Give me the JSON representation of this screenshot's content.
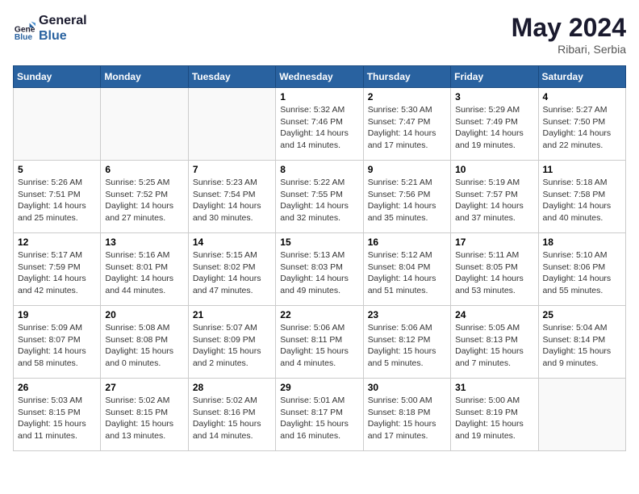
{
  "header": {
    "logo_line1": "General",
    "logo_line2": "Blue",
    "month": "May 2024",
    "location": "Ribari, Serbia"
  },
  "weekdays": [
    "Sunday",
    "Monday",
    "Tuesday",
    "Wednesday",
    "Thursday",
    "Friday",
    "Saturday"
  ],
  "weeks": [
    [
      {
        "day": "",
        "info": ""
      },
      {
        "day": "",
        "info": ""
      },
      {
        "day": "",
        "info": ""
      },
      {
        "day": "1",
        "info": "Sunrise: 5:32 AM\nSunset: 7:46 PM\nDaylight: 14 hours\nand 14 minutes."
      },
      {
        "day": "2",
        "info": "Sunrise: 5:30 AM\nSunset: 7:47 PM\nDaylight: 14 hours\nand 17 minutes."
      },
      {
        "day": "3",
        "info": "Sunrise: 5:29 AM\nSunset: 7:49 PM\nDaylight: 14 hours\nand 19 minutes."
      },
      {
        "day": "4",
        "info": "Sunrise: 5:27 AM\nSunset: 7:50 PM\nDaylight: 14 hours\nand 22 minutes."
      }
    ],
    [
      {
        "day": "5",
        "info": "Sunrise: 5:26 AM\nSunset: 7:51 PM\nDaylight: 14 hours\nand 25 minutes."
      },
      {
        "day": "6",
        "info": "Sunrise: 5:25 AM\nSunset: 7:52 PM\nDaylight: 14 hours\nand 27 minutes."
      },
      {
        "day": "7",
        "info": "Sunrise: 5:23 AM\nSunset: 7:54 PM\nDaylight: 14 hours\nand 30 minutes."
      },
      {
        "day": "8",
        "info": "Sunrise: 5:22 AM\nSunset: 7:55 PM\nDaylight: 14 hours\nand 32 minutes."
      },
      {
        "day": "9",
        "info": "Sunrise: 5:21 AM\nSunset: 7:56 PM\nDaylight: 14 hours\nand 35 minutes."
      },
      {
        "day": "10",
        "info": "Sunrise: 5:19 AM\nSunset: 7:57 PM\nDaylight: 14 hours\nand 37 minutes."
      },
      {
        "day": "11",
        "info": "Sunrise: 5:18 AM\nSunset: 7:58 PM\nDaylight: 14 hours\nand 40 minutes."
      }
    ],
    [
      {
        "day": "12",
        "info": "Sunrise: 5:17 AM\nSunset: 7:59 PM\nDaylight: 14 hours\nand 42 minutes."
      },
      {
        "day": "13",
        "info": "Sunrise: 5:16 AM\nSunset: 8:01 PM\nDaylight: 14 hours\nand 44 minutes."
      },
      {
        "day": "14",
        "info": "Sunrise: 5:15 AM\nSunset: 8:02 PM\nDaylight: 14 hours\nand 47 minutes."
      },
      {
        "day": "15",
        "info": "Sunrise: 5:13 AM\nSunset: 8:03 PM\nDaylight: 14 hours\nand 49 minutes."
      },
      {
        "day": "16",
        "info": "Sunrise: 5:12 AM\nSunset: 8:04 PM\nDaylight: 14 hours\nand 51 minutes."
      },
      {
        "day": "17",
        "info": "Sunrise: 5:11 AM\nSunset: 8:05 PM\nDaylight: 14 hours\nand 53 minutes."
      },
      {
        "day": "18",
        "info": "Sunrise: 5:10 AM\nSunset: 8:06 PM\nDaylight: 14 hours\nand 55 minutes."
      }
    ],
    [
      {
        "day": "19",
        "info": "Sunrise: 5:09 AM\nSunset: 8:07 PM\nDaylight: 14 hours\nand 58 minutes."
      },
      {
        "day": "20",
        "info": "Sunrise: 5:08 AM\nSunset: 8:08 PM\nDaylight: 15 hours\nand 0 minutes."
      },
      {
        "day": "21",
        "info": "Sunrise: 5:07 AM\nSunset: 8:09 PM\nDaylight: 15 hours\nand 2 minutes."
      },
      {
        "day": "22",
        "info": "Sunrise: 5:06 AM\nSunset: 8:11 PM\nDaylight: 15 hours\nand 4 minutes."
      },
      {
        "day": "23",
        "info": "Sunrise: 5:06 AM\nSunset: 8:12 PM\nDaylight: 15 hours\nand 5 minutes."
      },
      {
        "day": "24",
        "info": "Sunrise: 5:05 AM\nSunset: 8:13 PM\nDaylight: 15 hours\nand 7 minutes."
      },
      {
        "day": "25",
        "info": "Sunrise: 5:04 AM\nSunset: 8:14 PM\nDaylight: 15 hours\nand 9 minutes."
      }
    ],
    [
      {
        "day": "26",
        "info": "Sunrise: 5:03 AM\nSunset: 8:15 PM\nDaylight: 15 hours\nand 11 minutes."
      },
      {
        "day": "27",
        "info": "Sunrise: 5:02 AM\nSunset: 8:15 PM\nDaylight: 15 hours\nand 13 minutes."
      },
      {
        "day": "28",
        "info": "Sunrise: 5:02 AM\nSunset: 8:16 PM\nDaylight: 15 hours\nand 14 minutes."
      },
      {
        "day": "29",
        "info": "Sunrise: 5:01 AM\nSunset: 8:17 PM\nDaylight: 15 hours\nand 16 minutes."
      },
      {
        "day": "30",
        "info": "Sunrise: 5:00 AM\nSunset: 8:18 PM\nDaylight: 15 hours\nand 17 minutes."
      },
      {
        "day": "31",
        "info": "Sunrise: 5:00 AM\nSunset: 8:19 PM\nDaylight: 15 hours\nand 19 minutes."
      },
      {
        "day": "",
        "info": ""
      }
    ]
  ]
}
